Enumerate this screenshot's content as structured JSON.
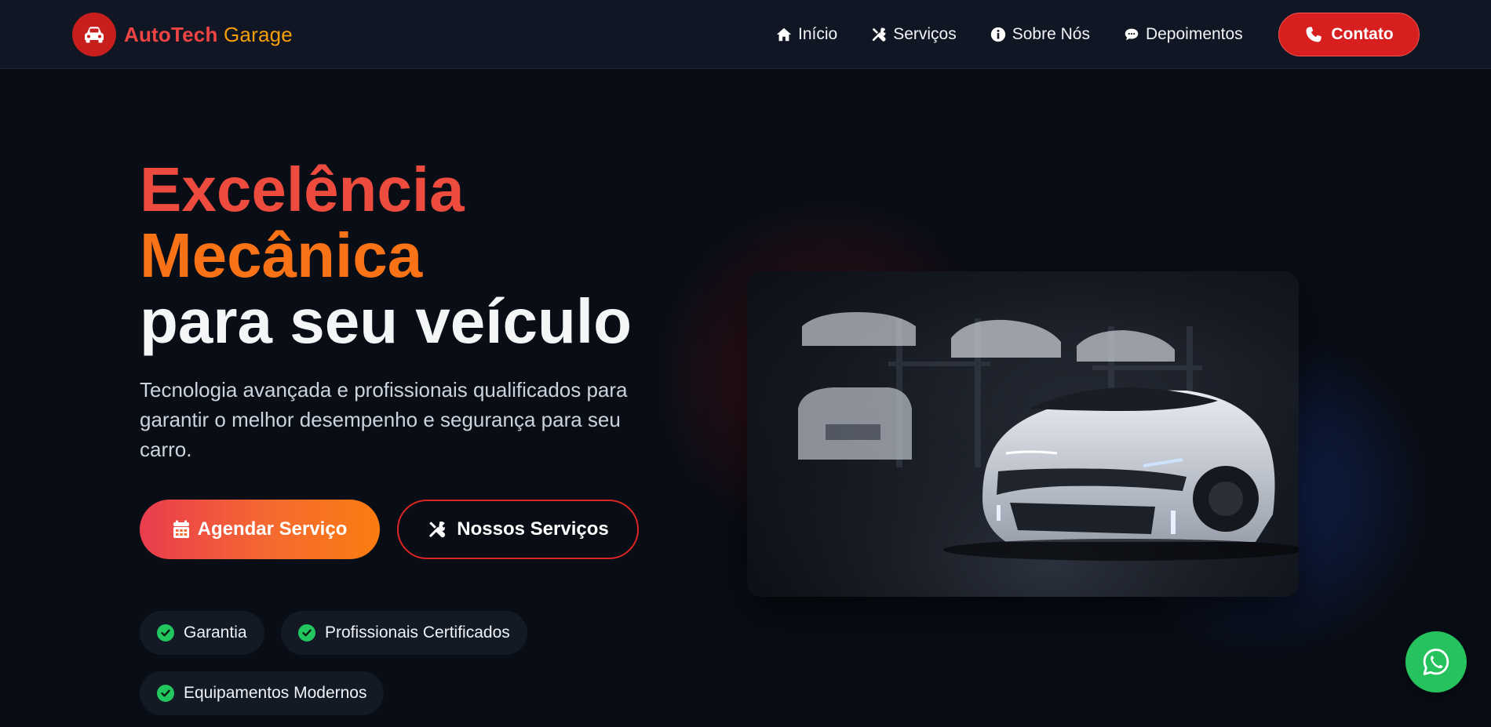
{
  "brand": {
    "name": "AutoTech",
    "suffix": "Garage",
    "icon": "car-icon"
  },
  "nav": {
    "items": [
      {
        "label": "Início",
        "icon": "home-icon"
      },
      {
        "label": "Serviços",
        "icon": "tools-icon"
      },
      {
        "label": "Sobre Nós",
        "icon": "info-icon"
      },
      {
        "label": "Depoimentos",
        "icon": "comment-icon"
      }
    ],
    "contact": {
      "label": "Contato",
      "icon": "phone-icon"
    }
  },
  "hero": {
    "title_line1": "Excelência",
    "title_line2": "Mecânica",
    "title_line3": "para seu veículo",
    "subtitle": "Tecnologia avançada e profissionais qualificados para garantir o melhor desempenho e segurança para seu carro.",
    "primary_button": {
      "label": "Agendar Serviço",
      "icon": "calendar-icon"
    },
    "secondary_button": {
      "label": "Nossos Serviços",
      "icon": "tools-icon"
    },
    "features": [
      "Garantia",
      "Profissionais Certificados",
      "Equipamentos Modernos"
    ]
  },
  "floating": {
    "icon": "whatsapp-icon"
  },
  "colors": {
    "accent_red": "#dc2626",
    "accent_orange": "#f97316",
    "success": "#22c55e",
    "background": "#090d16"
  }
}
